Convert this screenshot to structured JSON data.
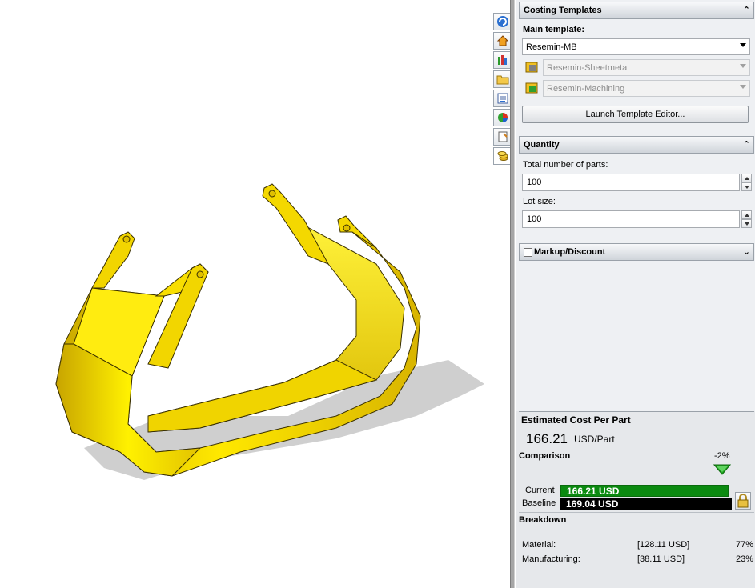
{
  "side_tabs": [
    {
      "name": "featuremanager-tab",
      "icon": "swirl-icon"
    },
    {
      "name": "home-tab",
      "icon": "house-icon"
    },
    {
      "name": "library-tab",
      "icon": "books-icon"
    },
    {
      "name": "explorer-tab",
      "icon": "folder-icon"
    },
    {
      "name": "view-palette-tab",
      "icon": "palette-icon"
    },
    {
      "name": "appearances-tab",
      "icon": "color-ball-icon"
    },
    {
      "name": "custom-properties-tab",
      "icon": "properties-icon"
    },
    {
      "name": "costing-tab",
      "icon": "coins-icon",
      "active": true
    }
  ],
  "costing_templates": {
    "header": "Costing Templates",
    "main_template_label": "Main template:",
    "main_template_value": "Resemin-MB",
    "sheetmetal_template_value": "Resemin-Sheetmetal",
    "machining_template_value": "Resemin-Machining",
    "launch_button": "Launch Template Editor..."
  },
  "quantity": {
    "header": "Quantity",
    "total_parts_label": "Total number of parts:",
    "total_parts_value": "100",
    "lot_size_label": "Lot size:",
    "lot_size_value": "100"
  },
  "markup": {
    "header": "Markup/Discount",
    "checked": false
  },
  "estimate": {
    "title": "Estimated Cost Per Part",
    "cost": "166.21",
    "unit": "USD/Part",
    "comparison_label": "Comparison",
    "delta": "-2%",
    "current_label": "Current",
    "current_value": "166.21 USD",
    "current_fraction": 0.983,
    "baseline_label": "Baseline",
    "baseline_value": "169.04 USD",
    "baseline_fraction": 1.0,
    "breakdown_label": "Breakdown",
    "rows": [
      {
        "label": "Material:",
        "value": "[128.11 USD]",
        "pct": "77%"
      },
      {
        "label": "Manufacturing:",
        "value": "[38.11 USD]",
        "pct": "23%"
      }
    ]
  },
  "colors": {
    "part_yellow": "#f5d800",
    "current_bar": "#0b8a10",
    "baseline_bar": "#000000",
    "delta_arrow": "#1fa31f"
  }
}
